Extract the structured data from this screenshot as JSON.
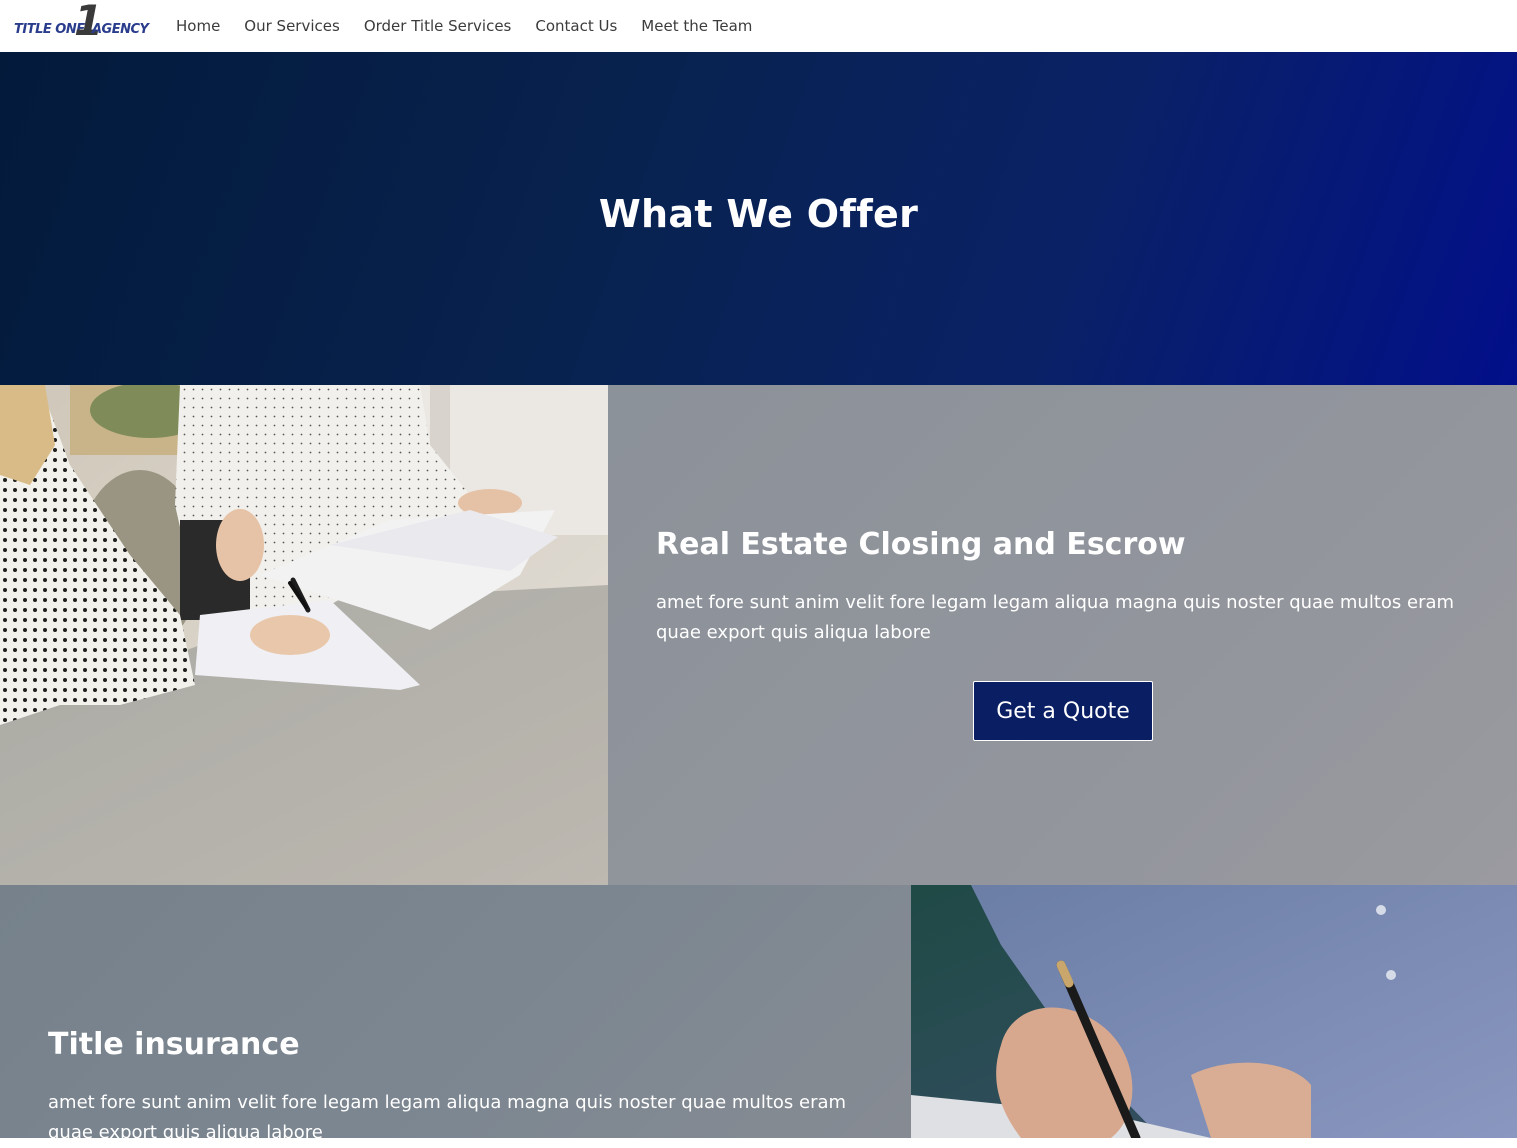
{
  "header": {
    "logo": {
      "left_text": "TITLE ONE",
      "numeral": "1",
      "right_text": "AGENCY"
    },
    "nav": [
      {
        "label": "Home"
      },
      {
        "label": "Our Services"
      },
      {
        "label": "Order Title Services"
      },
      {
        "label": "Contact Us"
      },
      {
        "label": "Meet the Team"
      }
    ]
  },
  "hero": {
    "title": "What We Offer"
  },
  "services": [
    {
      "title": "Real Estate Closing and Escrow",
      "description": "amet fore sunt anim velit fore legam legam aliqua magna quis noster quae multos eram quae export quis aliqua labore",
      "button_label": "Get a Quote"
    },
    {
      "title": "Title insurance",
      "description": "amet fore sunt anim velit fore legam legam aliqua magna quis noster quae multos eram quae export quis aliqua labore"
    }
  ],
  "colors": {
    "hero_dark": "#031a3b",
    "hero_bright": "#020f8a",
    "button_bg": "#0a1e63",
    "panel_gray": "#92959c",
    "nav_text": "#3c3c3c"
  }
}
